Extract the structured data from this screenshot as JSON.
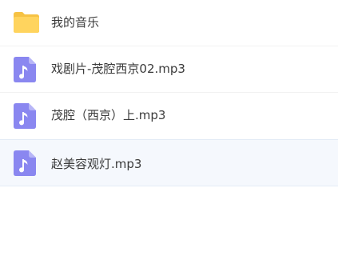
{
  "files": [
    {
      "name": "我的音乐",
      "type": "folder",
      "icon": "folder-icon"
    },
    {
      "name": "戏剧片-茂腔西京02.mp3",
      "type": "audio",
      "icon": "music-file-icon"
    },
    {
      "name": "茂腔（西京）上.mp3",
      "type": "audio",
      "icon": "music-file-icon"
    },
    {
      "name": "赵美容观灯.mp3",
      "type": "audio",
      "icon": "music-file-icon",
      "selected": true
    }
  ],
  "colors": {
    "folder": "#ffd45e",
    "music_icon": "#8a87f0",
    "selected_row_bg": "#f5f8fd",
    "text": "#3a3a3a"
  }
}
